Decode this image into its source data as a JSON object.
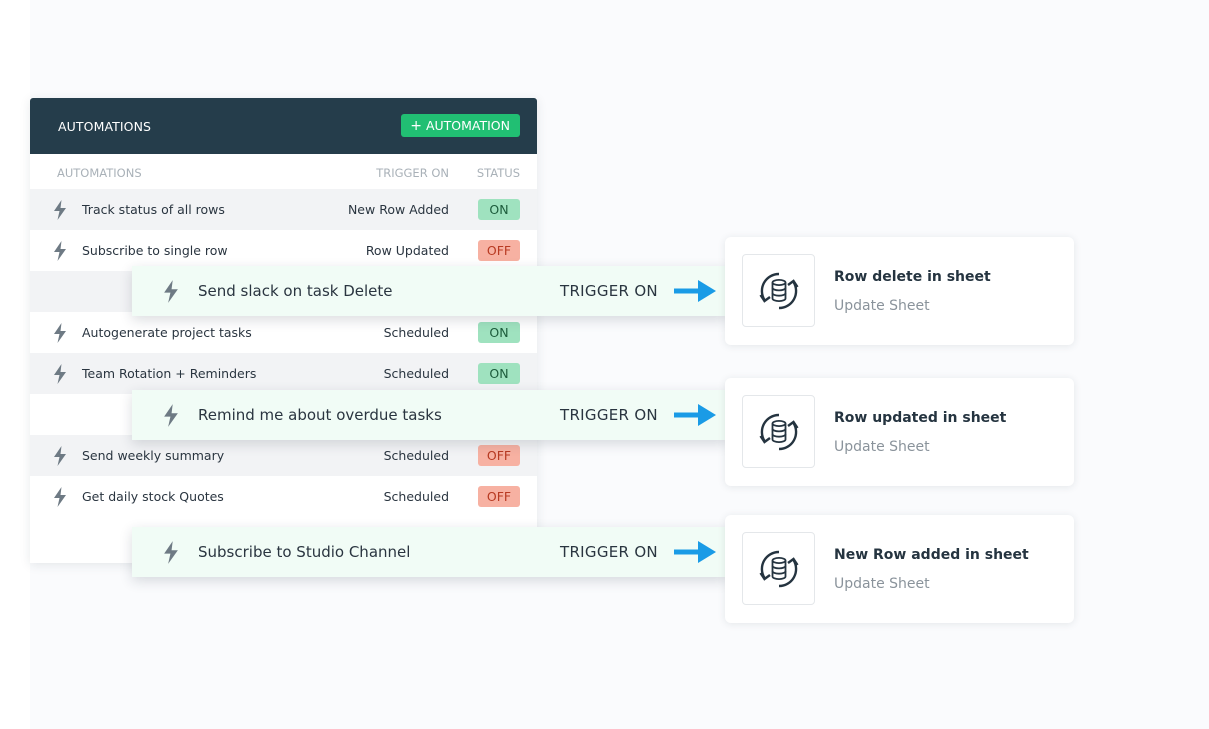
{
  "panel": {
    "title": "AUTOMATIONS",
    "add_button": {
      "icon": "plus-icon",
      "label": "AUTOMATION"
    },
    "columns": {
      "name": "AUTOMATIONS",
      "trigger": "TRIGGER ON",
      "status": "STATUS"
    },
    "rows": [
      {
        "name": "Track status of all rows",
        "trigger": "New Row Added",
        "status": "ON"
      },
      {
        "name": "Subscribe to single row",
        "trigger": "Row Updated",
        "status": "OFF"
      },
      {
        "name": "Autogenerate project tasks",
        "trigger": "Scheduled",
        "status": "ON"
      },
      {
        "name": "Team Rotation + Reminders",
        "trigger": "Scheduled",
        "status": "ON"
      },
      {
        "name": "Send weekly summary",
        "trigger": "Scheduled",
        "status": "OFF"
      },
      {
        "name": "Get daily stock Quotes",
        "trigger": "Scheduled",
        "status": "OFF"
      }
    ]
  },
  "highlights": [
    {
      "name": "Send slack on task Delete",
      "trigger": "TRIGGER ON",
      "icon": "arrow-right-icon"
    },
    {
      "name": "Remind me about overdue tasks",
      "trigger": "TRIGGER ON",
      "icon": "arrow-right-icon"
    },
    {
      "name": "Subscribe to Studio Channel",
      "trigger": "TRIGGER ON",
      "icon": "arrow-right-icon"
    }
  ],
  "cards": [
    {
      "title": "Row delete in sheet",
      "subtitle": "Update Sheet",
      "icon": "database-sync-icon"
    },
    {
      "title": "Row updated in sheet",
      "subtitle": "Update Sheet",
      "icon": "database-sync-icon"
    },
    {
      "title": "New Row added in sheet",
      "subtitle": "Update Sheet",
      "icon": "database-sync-icon"
    }
  ],
  "colors": {
    "header_bg": "#253d4b",
    "accent_green": "#21bf73",
    "status_on_bg": "#9fe2bf",
    "status_off_bg": "#f7b1a2",
    "arrow_blue": "#1a9be6",
    "highlight_bg": "#f1fcf6"
  }
}
